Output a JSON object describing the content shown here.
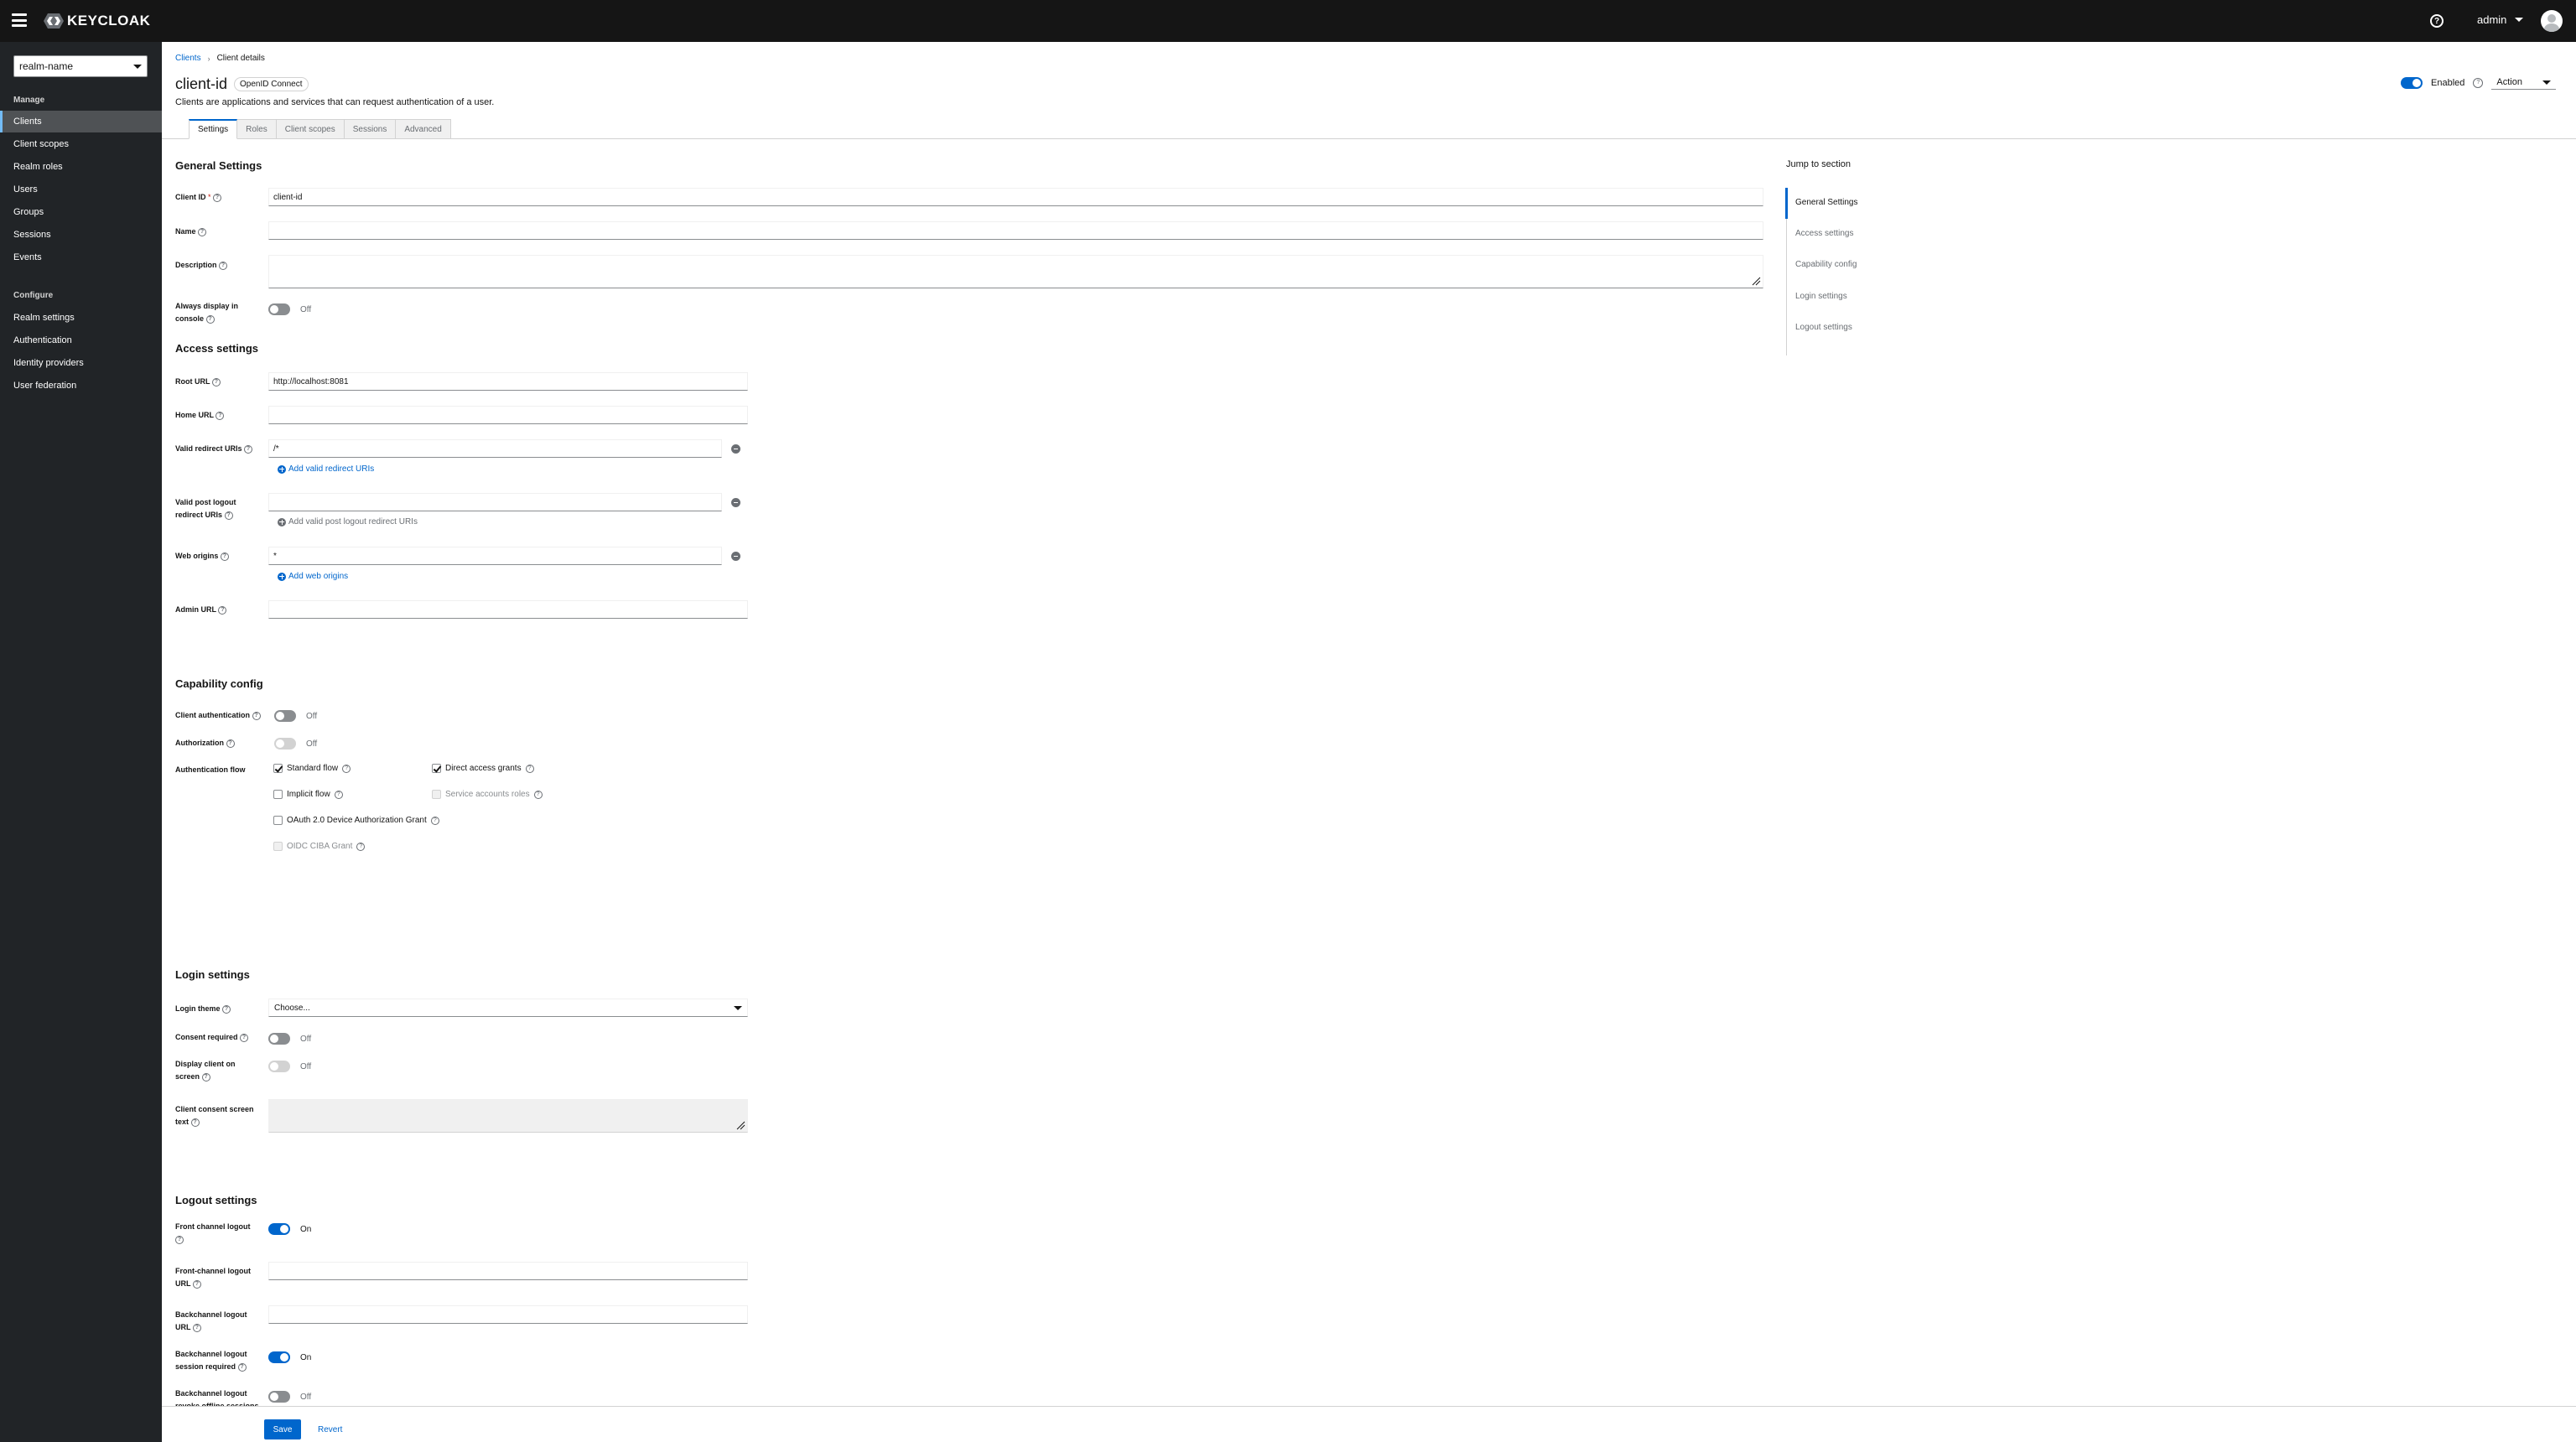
{
  "masthead": {
    "brand": "KEYCLOAK",
    "help_icon": "?",
    "user": "admin"
  },
  "sidebar": {
    "realm": "realm-name",
    "manage_title": "Manage",
    "manage_items": [
      {
        "label": "Clients",
        "active": true
      },
      {
        "label": "Client scopes"
      },
      {
        "label": "Realm roles"
      },
      {
        "label": "Users"
      },
      {
        "label": "Groups"
      },
      {
        "label": "Sessions"
      },
      {
        "label": "Events"
      }
    ],
    "configure_title": "Configure",
    "configure_items": [
      {
        "label": "Realm settings"
      },
      {
        "label": "Authentication"
      },
      {
        "label": "Identity providers"
      },
      {
        "label": "User federation"
      }
    ]
  },
  "header": {
    "breadcrumb": [
      "Clients",
      "Client details"
    ],
    "title": "client-id",
    "badge": "OpenID Connect",
    "description": "Clients are applications and services that can request authentication of a user.",
    "enabled_label": "Enabled",
    "action_label": "Action"
  },
  "tabs": [
    "Settings",
    "Roles",
    "Client scopes",
    "Sessions",
    "Advanced"
  ],
  "general": {
    "title": "General Settings",
    "client_id_label": "Client ID",
    "client_id_value": "client-id",
    "name_label": "Name",
    "description_label": "Description",
    "always_display_label": "Always display in console",
    "always_display_state": "Off"
  },
  "access": {
    "title": "Access settings",
    "root_url_label": "Root URL",
    "root_url_value": "http://localhost:8081",
    "home_url_label": "Home URL",
    "redirect_label": "Valid redirect URIs",
    "redirect_value": "/*",
    "add_redirect": "Add valid redirect URIs",
    "post_logout_label": "Valid post logout redirect URIs",
    "add_post_logout": "Add valid post logout redirect URIs",
    "web_origins_label": "Web origins",
    "web_origins_value": "*",
    "add_web_origins": "Add web origins",
    "admin_url_label": "Admin URL"
  },
  "capability": {
    "title": "Capability config",
    "client_auth_label": "Client authentication",
    "client_auth_state": "Off",
    "authorization_label": "Authorization",
    "authorization_state": "Off",
    "auth_flow_label": "Authentication flow",
    "flows": {
      "standard": "Standard flow",
      "direct": "Direct access grants",
      "implicit": "Implicit flow",
      "service": "Service accounts roles",
      "device": "OAuth 2.0 Device Authorization Grant",
      "ciba": "OIDC CIBA Grant"
    }
  },
  "login": {
    "title": "Login settings",
    "theme_label": "Login theme",
    "theme_value": "Choose...",
    "consent_label": "Consent required",
    "consent_state": "Off",
    "display_client_label": "Display client on screen",
    "display_client_state": "Off",
    "consent_text_label": "Client consent screen text"
  },
  "logout": {
    "title": "Logout settings",
    "front_channel_label": "Front channel logout",
    "front_channel_state": "On",
    "front_channel_url_label": "Front-channel logout URL",
    "backchannel_url_label": "Backchannel logout URL",
    "backchannel_session_label": "Backchannel logout session required",
    "backchannel_session_state": "On",
    "backchannel_revoke_label": "Backchannel logout revoke offline sessions",
    "backchannel_revoke_state": "Off"
  },
  "jump": {
    "title": "Jump to section",
    "items": [
      "General Settings",
      "Access settings",
      "Capability config",
      "Login settings",
      "Logout settings"
    ]
  },
  "footer": {
    "save": "Save",
    "revert": "Revert"
  },
  "colors": {
    "masthead": "#151515",
    "sidebar": "#212427",
    "primary": "#0066cc"
  }
}
